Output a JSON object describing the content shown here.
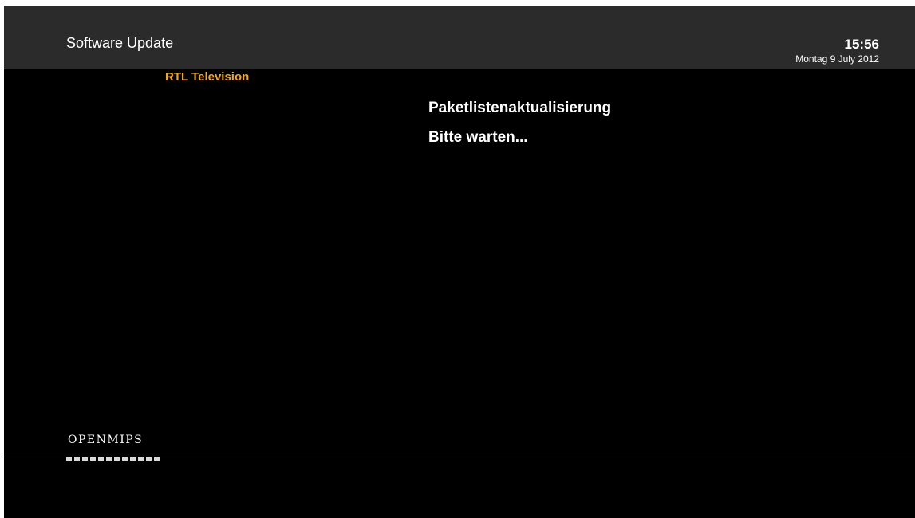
{
  "header": {
    "title": "Software Update",
    "clock": "15:56",
    "date": "Montag 9 July 2012"
  },
  "channel": {
    "name": "RTL Television"
  },
  "status": {
    "title": "Paketlistenaktualisierung",
    "message": "Bitte warten..."
  },
  "branding": {
    "logo_text": "OPENMIPS"
  },
  "colors": {
    "background": "#000000",
    "header": "#2b2b2b",
    "channel_accent": "#f0a820",
    "text": "#ffffff"
  }
}
